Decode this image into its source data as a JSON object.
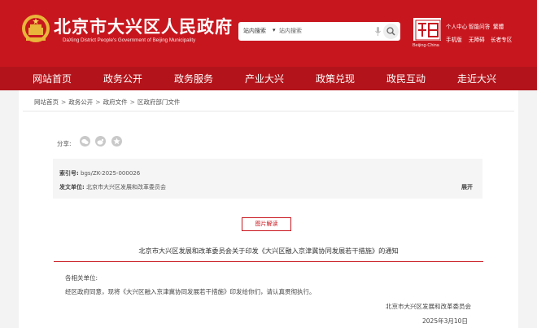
{
  "header": {
    "site_title": "北京市大兴区人民政府",
    "site_subtitle": "DaXing District People's Government of Beijing Municipality",
    "search": {
      "scope": "站内搜索",
      "placeholder": "站内搜索"
    },
    "capital_logo_caption": "Beijing·China",
    "tools": {
      "elder_mode": "个人中心",
      "smart_qa": "智能问答",
      "traditional": "繁體",
      "mobile": "手机版",
      "accessibility": "无障碍",
      "elder_zone": "长者专区"
    },
    "brand_color": "#c8161e"
  },
  "nav": {
    "items": [
      "网站首页",
      "政务公开",
      "政务服务",
      "产业大兴",
      "政策兑现",
      "政民互动",
      "走近大兴"
    ]
  },
  "breadcrumb": {
    "items": [
      "网站首页",
      "政务公开",
      "政府文件",
      "区政府部门文件"
    ],
    "separator": ">"
  },
  "share": {
    "label": "分享:",
    "icons": [
      "wechat-icon",
      "weibo-icon",
      "qzone-icon"
    ]
  },
  "meta": {
    "index_label": "索引号:",
    "index_value": "bgs/ZK-2025-000026",
    "issuer_label": "发文单位:",
    "issuer_value": "北京市大兴区发展和改革委员会",
    "expand": "展开"
  },
  "doc": {
    "tujie_button": "图片解读",
    "title": "北京市大兴区发展和改革委员会关于印发《大兴区融入京津冀协同发展若干措施》的通知",
    "salutation": "各相关单位:",
    "paragraph": "经区政府同意，现将《大兴区融入京津冀协同发展若干措施》印发给你们，请认真贯彻执行。",
    "signature": "北京市大兴区发展和改革委员会",
    "date": "2025年3月10日"
  }
}
